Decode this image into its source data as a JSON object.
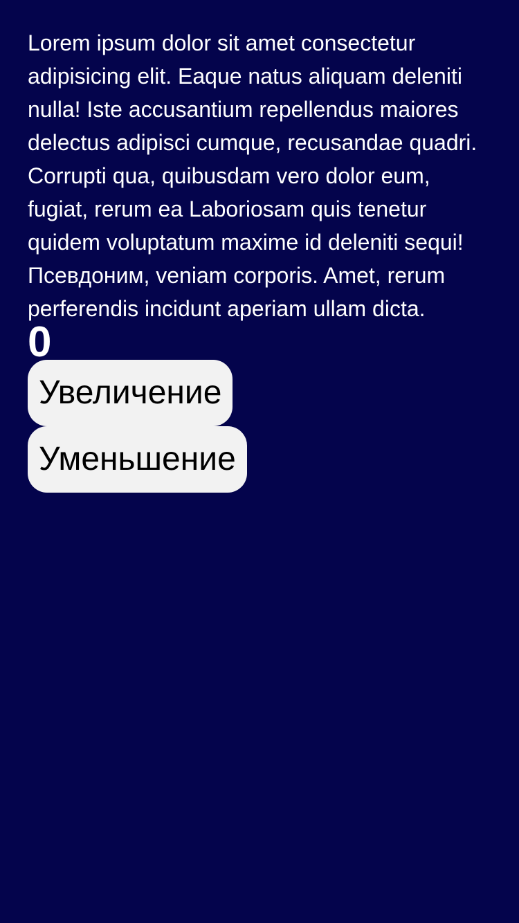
{
  "content": {
    "text_lines": [
      "Lorem ipsum dolor sit amet consectetur",
      "adipisicing elit. Eaque natus aliquam deleniti",
      "nulla! Iste accusantium repellendus maiores",
      "delectus adipisci cumque, recusandae quadri.",
      "Corrupti qua, quibusdam vero dolor eum,",
      "fugiat, rerum ea Laboriosam quis tenetur",
      "quidem voluptatum maxime id deleniti sequi!",
      "Псевдоним, veniam corporis. Amet, rerum",
      "perferendis incidunt aperiam ullam dicta."
    ]
  },
  "counter": {
    "value": "0"
  },
  "buttons": {
    "increase_label": "Увеличение",
    "decrease_label": "Уменьшение"
  },
  "colors": {
    "background": "#04044c",
    "text": "#ffffff",
    "button_background": "#f2f2f2",
    "button_text": "#000000"
  }
}
